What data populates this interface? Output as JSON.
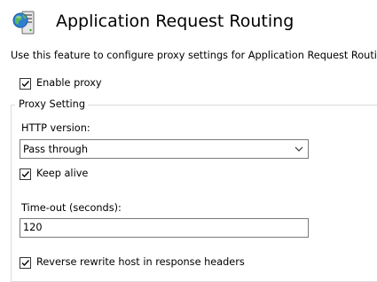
{
  "header": {
    "icon": "server-globe-icon",
    "title": "Application Request Routing"
  },
  "description": "Use this feature to configure proxy settings for Application Request Routing.",
  "enable_proxy": {
    "label": "Enable proxy",
    "checked": true
  },
  "proxy_setting": {
    "legend": "Proxy Setting",
    "http_version": {
      "label": "HTTP version:",
      "value": "Pass through"
    },
    "keep_alive": {
      "label": "Keep alive",
      "checked": true
    },
    "timeout": {
      "label": "Time-out (seconds):",
      "value": "120"
    },
    "reverse_rewrite": {
      "label": "Reverse rewrite host in response headers",
      "checked": true
    }
  }
}
